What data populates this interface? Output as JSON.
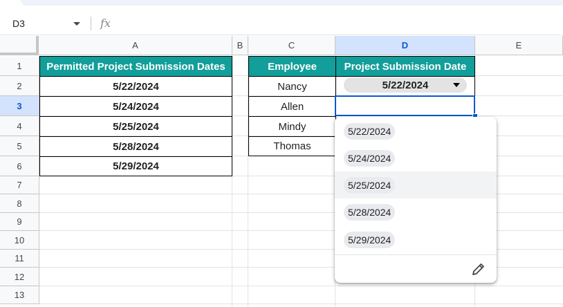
{
  "formula_bar": {
    "cell_ref": "D3",
    "fx_symbol": "fx"
  },
  "columns": [
    "A",
    "B",
    "C",
    "D",
    "E"
  ],
  "rows": [
    "1",
    "2",
    "3",
    "4",
    "5",
    "6",
    "7",
    "8",
    "9",
    "10",
    "11",
    "12",
    "13"
  ],
  "table1": {
    "header": "Permitted Project Submission Dates",
    "dates": [
      "5/22/2024",
      "5/24/2024",
      "5/25/2024",
      "5/28/2024",
      "5/29/2024"
    ]
  },
  "table2": {
    "header_employee": "Employee",
    "header_date": "Project Submission Date",
    "employees": [
      "Nancy",
      "Allen",
      "Mindy",
      "Thomas"
    ],
    "d2_value": "5/22/2024"
  },
  "dropdown": {
    "options": [
      "5/22/2024",
      "5/24/2024",
      "5/25/2024",
      "5/28/2024",
      "5/29/2024"
    ],
    "highlighted_index": 2,
    "edit_icon": "pencil-icon"
  },
  "colors": {
    "header_teal": "#129e9a",
    "selection_blue": "#0b57d0",
    "selected_header_bg": "#d3e3fd"
  }
}
